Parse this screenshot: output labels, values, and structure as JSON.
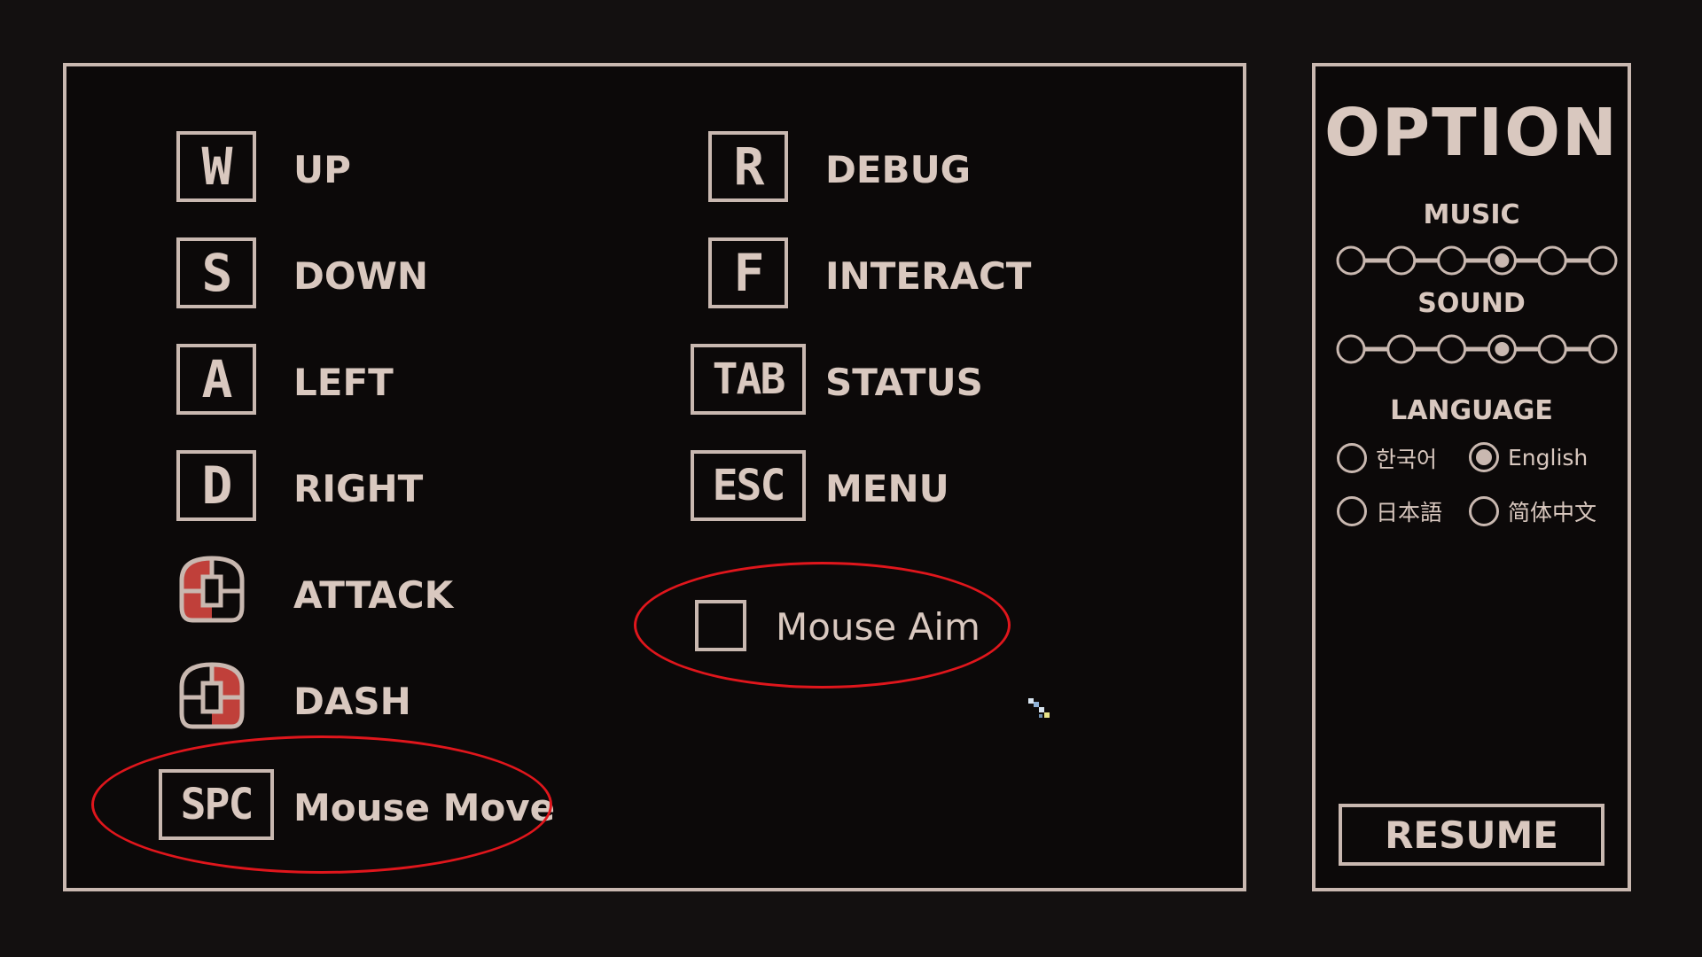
{
  "controls": {
    "keys": [
      {
        "key": "W",
        "action": "UP"
      },
      {
        "key": "S",
        "action": "DOWN"
      },
      {
        "key": "A",
        "action": "LEFT"
      },
      {
        "key": "D",
        "action": "RIGHT"
      },
      {
        "key": "R",
        "action": "DEBUG"
      },
      {
        "key": "F",
        "action": "INTERACT"
      },
      {
        "key": "TAB",
        "action": "STATUS"
      },
      {
        "key": "ESC",
        "action": "MENU"
      },
      {
        "key": "SPC",
        "action": "Mouse Move"
      }
    ],
    "mouse_actions": [
      {
        "icon": "mouse-left-click-icon",
        "action": "ATTACK"
      },
      {
        "icon": "mouse-right-click-icon",
        "action": "DASH"
      }
    ],
    "mouse_aim": {
      "label": "Mouse Aim",
      "checked": false
    }
  },
  "option": {
    "title": "OPTION",
    "music": {
      "label": "MUSIC",
      "steps": 6,
      "selected_index": 3
    },
    "sound": {
      "label": "SOUND",
      "steps": 6,
      "selected_index": 3
    },
    "language": {
      "label": "LANGUAGE",
      "options": [
        "한국어",
        "English",
        "日本語",
        "简体中文"
      ],
      "selected": "English"
    },
    "resume_label": "RESUME"
  },
  "colors": {
    "background": "#131010",
    "panel": "#0c0909",
    "border": "#c9b8b0",
    "text": "#d9c8bf",
    "mouse_highlight": "#c0403a",
    "annotation": "#e0161c"
  }
}
